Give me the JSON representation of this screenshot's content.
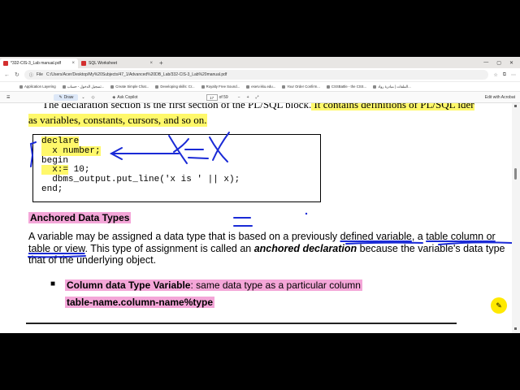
{
  "tabs": [
    {
      "label": "*332-CIS-3_Lab manual.pdf",
      "active": true
    },
    {
      "label": "SQL Worksheet",
      "active": false
    }
  ],
  "address": {
    "prefix": "File",
    "url": "C:/Users/Acer/Desktop/My%20Subjects/47_1/Advanced%20DB_Lab/332-CIS-3_Lab%20manual.pdf"
  },
  "bookmarks": [
    "Application Layering",
    "تسجيل الدخول - حساب...",
    "Create Simple Chat...",
    "Developing skills: Cr...",
    "Royalty Free Sound...",
    "eserv.kku.edu...",
    "Your Order Confirm...",
    "CSSBattle - the CSS...",
    "الملفات | مبادرة رواد..."
  ],
  "pdf_toolbar": {
    "draw": "Draw",
    "copilot": "Ask Copilot",
    "page_current": "17",
    "page_total": "of 59",
    "edit": "Edit with Acrobat"
  },
  "doc": {
    "line1_plain": "The declaration section is the first section of the PL/SQL block.",
    "line1_hl": " It contains definitions of PL/SQL ider",
    "line2": "as variables, constants, cursors, and so on.",
    "code": {
      "l1": "declare",
      "l2": "  x number;",
      "l3": "begin",
      "l4_hl": "  x:=",
      "l4_rest": " 10;",
      "l5": "  dbms_output.put_line('x is ' || x);",
      "l6": "end;"
    },
    "section_title": "Anchored Data Types",
    "para": {
      "a": "A variable may be assigned a data type that is based on a previously ",
      "b": "defined variable",
      "c": ", a ",
      "d": "table column or",
      "e": "table or view",
      "f": ". This type of assignment is called an ",
      "g": "anchored declaration",
      "h": " because the variable's data type",
      "i": "that of the underlying object."
    },
    "bullet_bold": "Column data Type Variable",
    "bullet_rest": ": same data type as a particular column",
    "syntax": "table-name.column-name%type"
  },
  "colors": {
    "highlight_yellow": "#fff86a",
    "highlight_pink": "#f4a6d8",
    "ink_blue": "#1a2ad6"
  }
}
